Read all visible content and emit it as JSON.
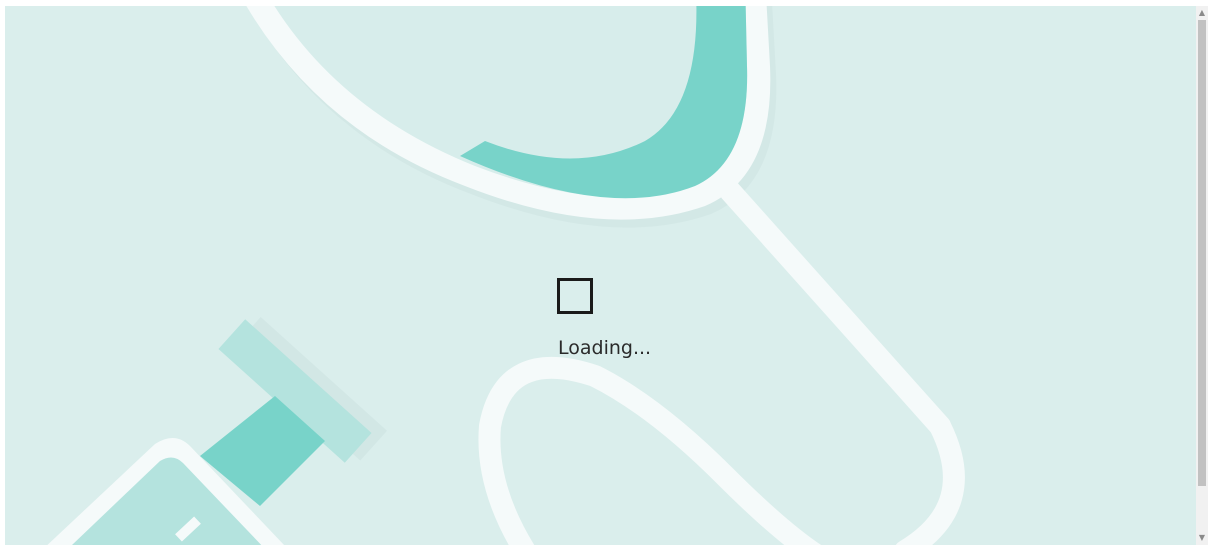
{
  "status": {
    "loading_text": "Loading..."
  },
  "scrollbar": {
    "up_arrow_icon": "triangle-up-icon",
    "down_arrow_icon": "triangle-down-icon"
  },
  "theme": {
    "background": "#daeeec",
    "accent": "#78d3c9",
    "light_accent": "#b4e3de",
    "outline": "#f5fafa"
  },
  "icons": {
    "loader": "square-spinner-icon",
    "background": [
      "stethoscope-illustration",
      "syringe-illustration"
    ]
  }
}
